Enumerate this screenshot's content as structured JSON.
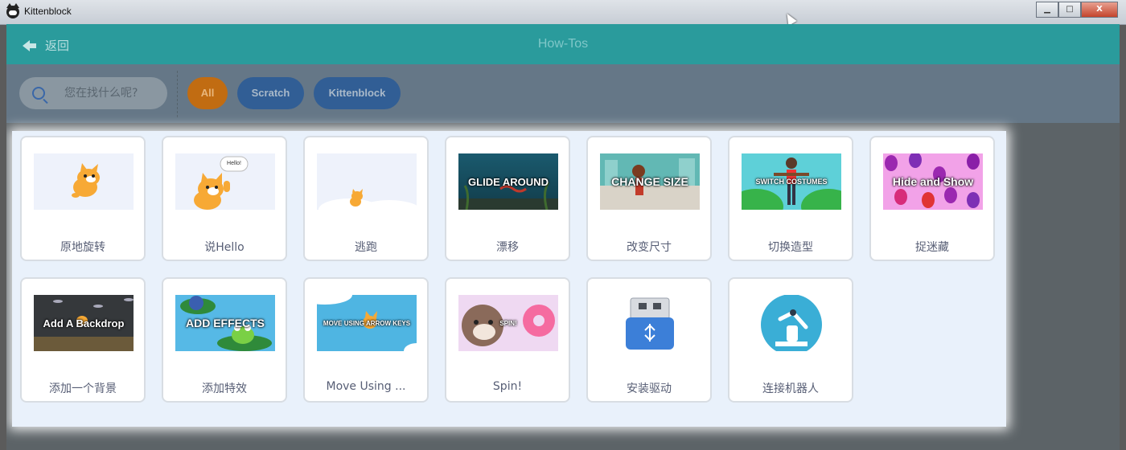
{
  "window": {
    "title": "Kittenblock",
    "icons": {
      "minimize": "minimize-icon",
      "maximize": "maximize-icon",
      "close": "close-icon"
    },
    "minimize_glyph": "▁",
    "maximize_glyph": "□",
    "close_glyph": "X"
  },
  "header": {
    "back_label": "返回",
    "title": "How-Tos"
  },
  "filters": {
    "search_placeholder": "您在找什么呢?",
    "chips": [
      "All",
      "Scratch",
      "Kittenblock"
    ]
  },
  "cards": [
    {
      "label": "原地旋转",
      "thumb_text": ""
    },
    {
      "label": "说Hello",
      "thumb_text": "Hello!"
    },
    {
      "label": "逃跑",
      "thumb_text": ""
    },
    {
      "label": "漂移",
      "thumb_text": "GLIDE AROUND"
    },
    {
      "label": "改变尺寸",
      "thumb_text": "CHANGE SIZE"
    },
    {
      "label": "切换造型",
      "thumb_text": "SWITCH COSTUMES"
    },
    {
      "label": "捉迷藏",
      "thumb_text": "Hide and Show"
    },
    {
      "label": "添加一个背景",
      "thumb_text": "Add A Backdrop"
    },
    {
      "label": "添加特效",
      "thumb_text": "ADD EFFECTS"
    },
    {
      "label": "Move Using ...",
      "thumb_text": "MOVE USING ARROW KEYS"
    },
    {
      "label": "Spin!",
      "thumb_text": "SPIN!"
    },
    {
      "label": "安装驱动",
      "thumb_text": ""
    },
    {
      "label": "连接机器人",
      "thumb_text": ""
    }
  ],
  "colors": {
    "header": "#2a9b9c",
    "chip_active": "#c16c12",
    "chip": "#315e95",
    "panel": "#e9f1fb"
  }
}
